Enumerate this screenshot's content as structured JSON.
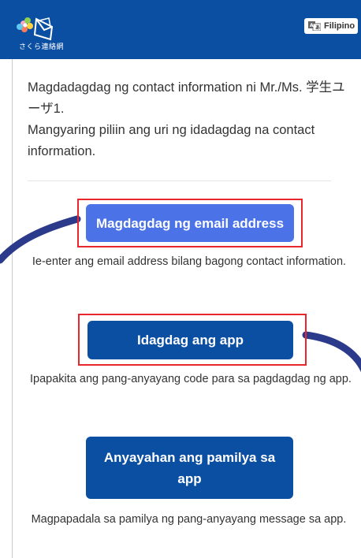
{
  "header": {
    "logo_text": "さくら連絡網",
    "language_label": "Filipino",
    "language_icon": "translate-icon"
  },
  "intro": {
    "line1": "Magdadagdag ng contact information ni Mr./Ms. 学生ユーザ1.",
    "line2": "Mangyaring piliin ang uri ng idadagdag na contact information."
  },
  "options": [
    {
      "button_label": "Magdagdag ng email address",
      "description": "Ie-enter ang email address bilang bagong contact information."
    },
    {
      "button_label": "Idagdag ang app",
      "description": "Ipapakita ang pang-anyayang code para sa pagdagdag ng app."
    },
    {
      "button_label": "Anyayahan ang pamilya sa app",
      "description": "Magpapadala sa pamilya ng pang-anyayang message sa app."
    }
  ],
  "colors": {
    "header_bg": "#0b4fa2",
    "primary_button": "#0b4fa2",
    "email_button": "#4b72e6",
    "highlight_box": "#e8262b",
    "arrow_arc": "#2c3a8c"
  }
}
